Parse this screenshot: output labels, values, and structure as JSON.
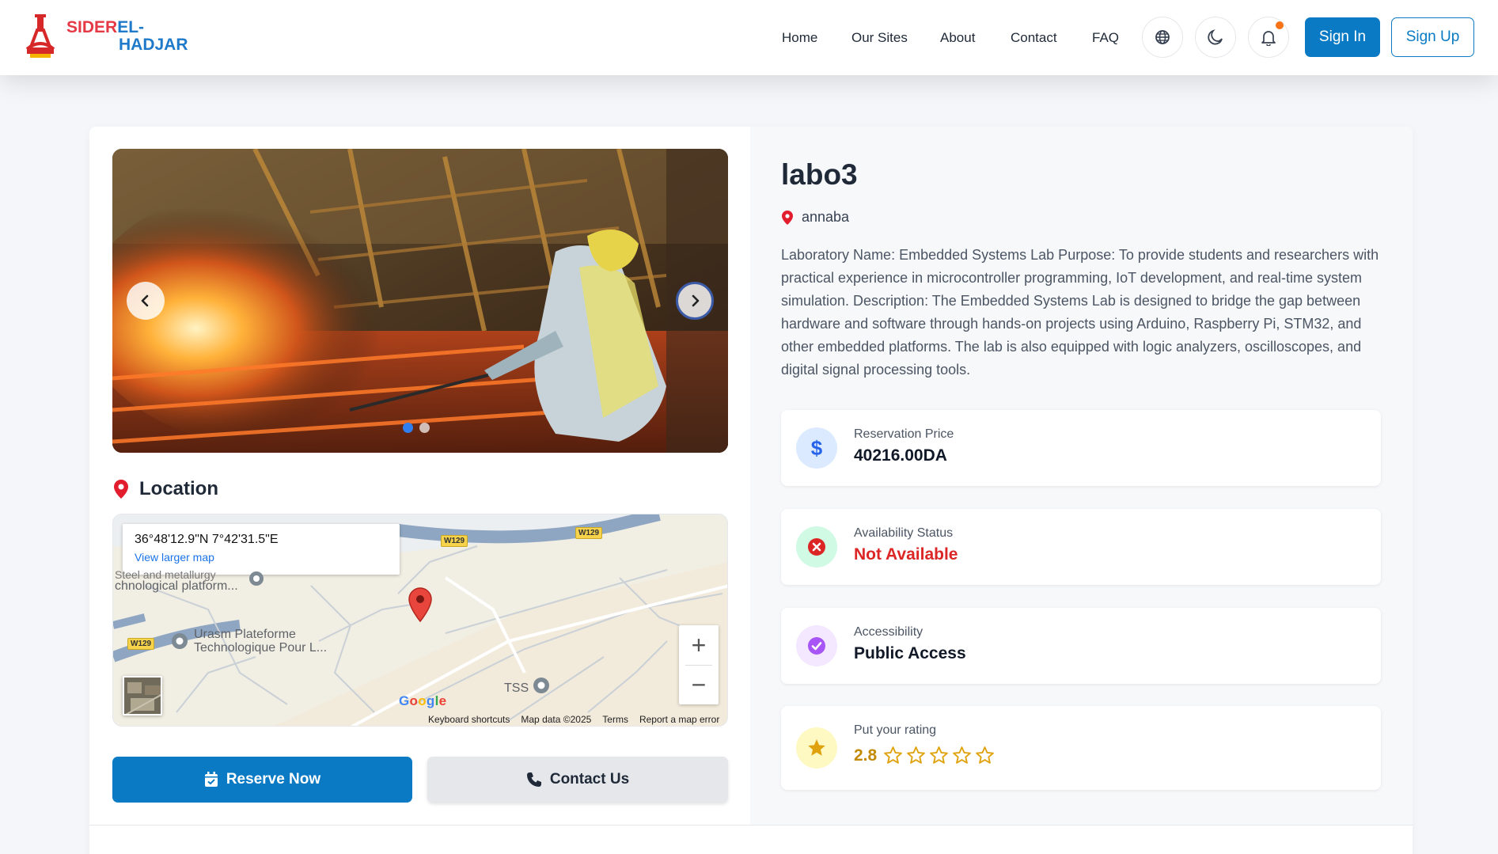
{
  "header": {
    "logo_line1_red": "SIDER",
    "logo_line1_blue": "EL-",
    "logo_line2": "HADJAR",
    "nav": [
      "Home",
      "Our Sites",
      "About",
      "Contact",
      "FAQ"
    ],
    "sign_in": "Sign In",
    "sign_up": "Sign Up",
    "icons": [
      "globe-icon",
      "moon-icon",
      "bell-icon"
    ],
    "notification_dot_color": "#f97316"
  },
  "gallery": {
    "slide_count": 2,
    "active_slide": 0
  },
  "location": {
    "title": "Location",
    "coords": "36°48'12.9\"N 7°42'31.5\"E",
    "view_larger": "View larger map",
    "labels": {
      "place1_line1": "Steel and metallurgy",
      "place1_line2": "chnological platform...",
      "place2_line1": "Urasm Plateforme",
      "place2_line2": "Technologique Pour L...",
      "place3": "TSS"
    },
    "road": "W129",
    "footer": [
      "Keyboard shortcuts",
      "Map data ©2025",
      "Terms",
      "Report a map error"
    ],
    "zoom_in": "+",
    "zoom_out": "−"
  },
  "actions": {
    "reserve": "Reserve Now",
    "contact": "Contact Us"
  },
  "lab": {
    "name": "labo3",
    "city": "annaba",
    "description": "Laboratory Name: Embedded Systems Lab Purpose: To provide students and researchers with practical experience in microcontroller programming, IoT development, and real-time system simulation. Description: The Embedded Systems Lab is designed to bridge the gap between hardware and software through hands-on projects using Arduino, Raspberry Pi, STM32, and other embedded platforms. The lab is also equipped with logic analyzers, oscilloscopes, and digital signal processing tools."
  },
  "info": {
    "price_label": "Reservation Price",
    "price_value": "40216.00DA",
    "availability_label": "Availability Status",
    "availability_value": "Not Available",
    "accessibility_label": "Accessibility",
    "accessibility_value": "Public Access",
    "rating_label": "Put your rating",
    "rating_value": "2.8",
    "rating_stars_filled": 0,
    "rating_stars_total": 5
  },
  "colors": {
    "primary": "#0a7ac4",
    "danger": "#dc2626",
    "accent_star": "#e0a20c",
    "purple": "#a855f7"
  }
}
